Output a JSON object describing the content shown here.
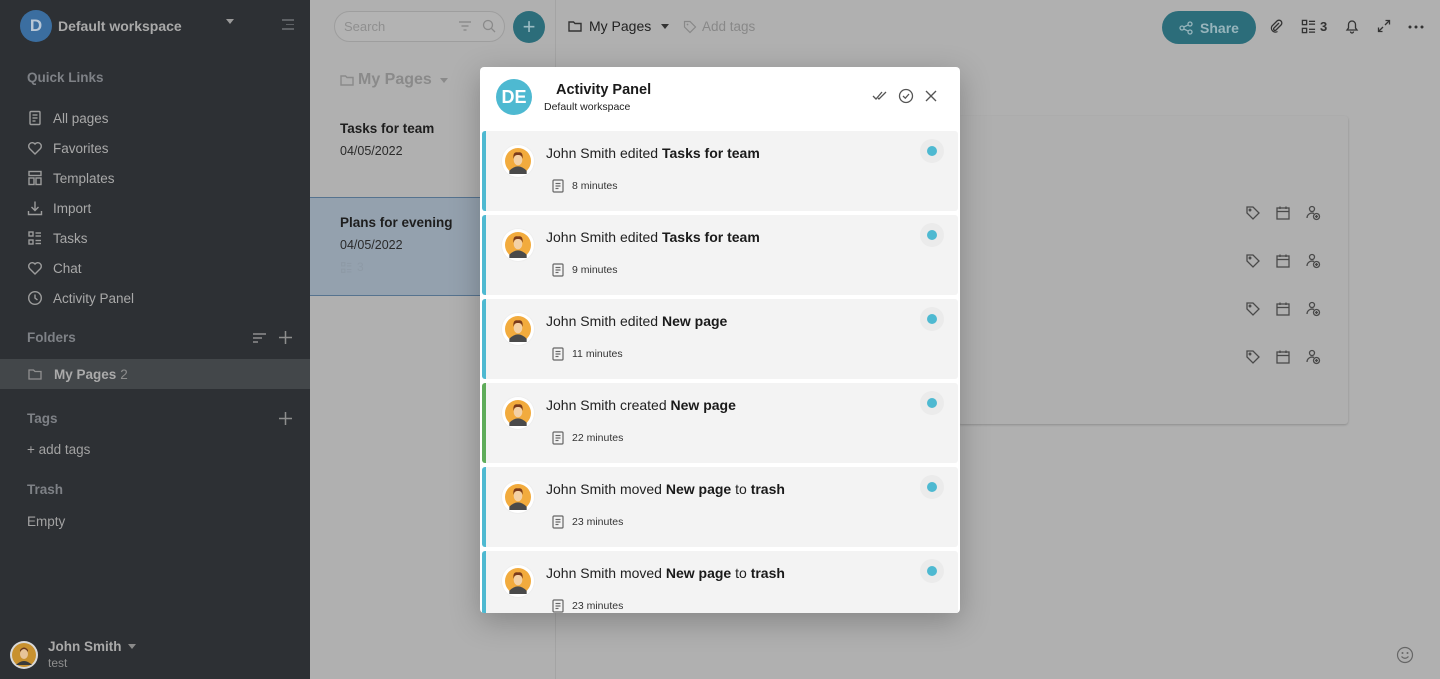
{
  "sidebar": {
    "workspace": {
      "initial": "D",
      "name": "Default workspace"
    },
    "quick_links_title": "Quick Links",
    "quick_links": [
      {
        "label": "All pages",
        "icon": "page-icon"
      },
      {
        "label": "Favorites",
        "icon": "heart-icon"
      },
      {
        "label": "Templates",
        "icon": "templates-icon"
      },
      {
        "label": "Import",
        "icon": "import-icon"
      },
      {
        "label": "Tasks",
        "icon": "tasks-icon"
      },
      {
        "label": "Chat",
        "icon": "heart-icon"
      },
      {
        "label": "Activity Panel",
        "icon": "clock-icon"
      }
    ],
    "folders_title": "Folders",
    "folders": [
      {
        "name": "My Pages",
        "count": "2"
      }
    ],
    "tags_title": "Tags",
    "add_tags": "+ add tags",
    "trash_title": "Trash",
    "trash_status": "Empty",
    "user": {
      "name": "John Smith",
      "subtitle": "test"
    }
  },
  "middle": {
    "search_placeholder": "Search",
    "add_label": "+",
    "list_title": "My Pages",
    "pages": [
      {
        "title": "Tasks for team",
        "date": "04/05/2022",
        "task_count": ""
      },
      {
        "title": "Plans for evening",
        "date": "04/05/2022",
        "task_count": "3"
      }
    ]
  },
  "topbar": {
    "breadcrumb": "My Pages",
    "add_tags": "Add tags",
    "share_label": "Share",
    "tasks_count": "3"
  },
  "modal": {
    "avatar_initials": "DE",
    "title": "Activity Panel",
    "subtitle": "Default workspace",
    "activities": [
      {
        "user": "John Smith",
        "action": "edited",
        "target": "Tasks for team",
        "suffix": "",
        "suffix_target": "",
        "time": "8 minutes",
        "accent": "#4eb9d1"
      },
      {
        "user": "John Smith",
        "action": "edited",
        "target": "Tasks for team",
        "suffix": "",
        "suffix_target": "",
        "time": "9 minutes",
        "accent": "#4eb9d1"
      },
      {
        "user": "John Smith",
        "action": "edited",
        "target": "New page",
        "suffix": "",
        "suffix_target": "",
        "time": "11 minutes",
        "accent": "#4eb9d1"
      },
      {
        "user": "John Smith",
        "action": "created",
        "target": "New page",
        "suffix": "",
        "suffix_target": "",
        "time": "22 minutes",
        "accent": "#5fac5a"
      },
      {
        "user": "John Smith",
        "action": "moved",
        "target": "New page",
        "suffix": "to",
        "suffix_target": "trash",
        "time": "23 minutes",
        "accent": "#4eb9d1"
      },
      {
        "user": "John Smith",
        "action": "moved",
        "target": "New page",
        "suffix": "to",
        "suffix_target": "trash",
        "time": "23 minutes",
        "accent": "#4eb9d1"
      }
    ]
  },
  "colors": {
    "brand_teal": "#2c6d7a",
    "activity_blue": "#4eb9d1",
    "activity_green": "#5fac5a",
    "sidebar_bg": "#2d3034"
  }
}
